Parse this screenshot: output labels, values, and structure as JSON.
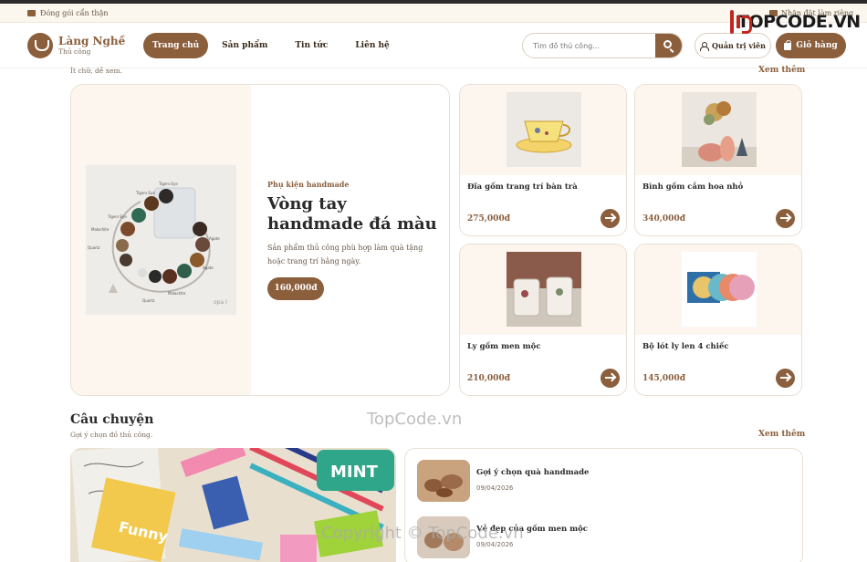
{
  "announcement": {
    "left": "Đóng gói cẩn thận",
    "right": "Nhận đặt làm riêng"
  },
  "watermark_logo": {
    "text": "TOPCODE.VN"
  },
  "brand": {
    "name": "Làng Nghề",
    "sub": "Thủ công"
  },
  "nav": [
    "Trang chủ",
    "Sản phẩm",
    "Tin tức",
    "Liên hệ"
  ],
  "search": {
    "placeholder": "Tìm đồ thủ công..."
  },
  "header_actions": {
    "admin": "Quản trị viên",
    "cart": "Giỏ hàng"
  },
  "products_section": {
    "subtitle": "Ít chữ, dễ xem.",
    "see_more": "Xem thêm"
  },
  "featured": {
    "category": "Phụ kiện handmade",
    "title": "Vòng tay handmade đá màu",
    "description": "Sản phẩm thủ công phù hợp làm quà tặng hoặc trang trí hằng ngày.",
    "price": "160,000đ",
    "image_labels": [
      "Tigers Eye",
      "Tigers Eye",
      "Malachite",
      "Agate",
      "Quartz",
      "Agate",
      "Tigers Eye",
      "Malachite",
      "Quartz",
      "opa l"
    ]
  },
  "products": [
    {
      "name": "Đĩa gốm trang trí bàn trà",
      "price": "275,000đ",
      "thumb": "teacup"
    },
    {
      "name": "Bình gốm cắm hoa nhỏ",
      "price": "340,000đ",
      "thumb": "vase"
    },
    {
      "name": "Ly gốm men mộc",
      "price": "210,000đ",
      "thumb": "cups"
    },
    {
      "name": "Bộ lót ly len 4 chiếc",
      "price": "145,000đ",
      "thumb": "coaster"
    }
  ],
  "story_section": {
    "title": "Câu chuyện",
    "subtitle": "Gợi ý chọn đồ thủ công.",
    "see_more": "Xem thêm",
    "image_words": [
      "MINT",
      "Funny"
    ]
  },
  "posts": [
    {
      "title": "Gợi ý chọn quà handmade",
      "date": "09/04/2026"
    },
    {
      "title": "Vẻ đẹp của gốm men mộc",
      "date": "09/04/2026"
    }
  ],
  "watermarks": [
    "TopCode.vn",
    "Copyright © TopCode.vn"
  ],
  "colors": {
    "accent": "#8b5e3c",
    "cream": "#fdf6ee",
    "text": "#2a2a2a"
  }
}
